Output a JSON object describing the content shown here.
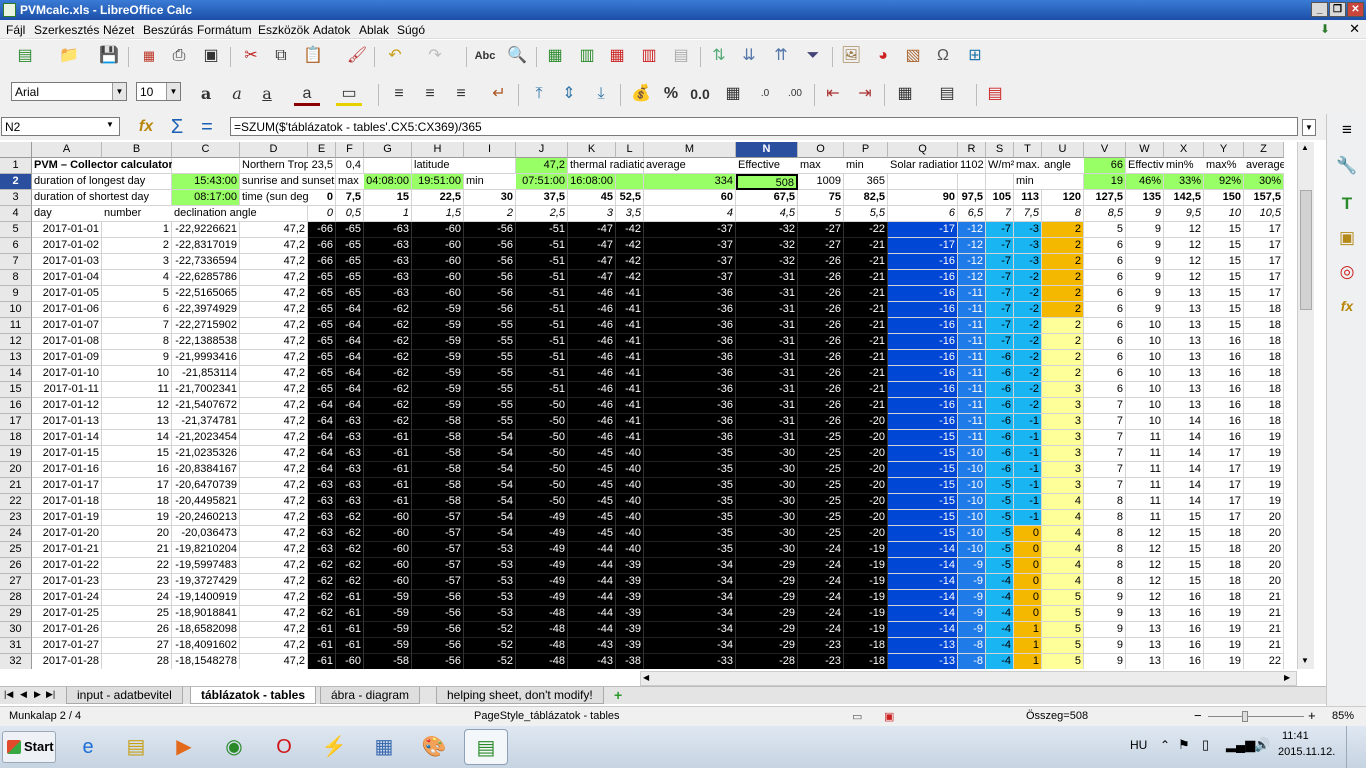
{
  "window": {
    "title": "PVMcalc.xls - LibreOffice Calc"
  },
  "menu": [
    "Fájl",
    "Szerkesztés",
    "Nézet",
    "Beszúrás",
    "Formátum",
    "Eszközök",
    "Adatok",
    "Ablak",
    "Súgó"
  ],
  "toolbar": {
    "font_name": "Arial",
    "font_size": "10",
    "percent_label": "%",
    "decimal_label": "0.0"
  },
  "formula_bar": {
    "name_box": "N2",
    "formula": "=SZUM($'táblázatok - tables'.CX5:CX369)/365"
  },
  "sheet": {
    "columns": [
      "A",
      "B",
      "C",
      "D",
      "E",
      "F",
      "G",
      "H",
      "I",
      "J",
      "K",
      "L",
      "M",
      "N",
      "O",
      "P",
      "Q",
      "R",
      "S",
      "T",
      "U",
      "V",
      "W",
      "X",
      "Y",
      "Z"
    ],
    "header_rows": [
      {
        "row": "1",
        "cells": [
          [
            "A",
            "PVM – Collector calculator"
          ],
          [
            "D",
            "Northern Tropic"
          ],
          [
            "E",
            "23,5"
          ],
          [
            "F",
            "0,4"
          ],
          [
            "H",
            "latitude"
          ],
          [
            "J",
            "47,2"
          ],
          [
            "K",
            "thermal radiation"
          ],
          [
            "M",
            "average"
          ],
          [
            "N",
            "Effective"
          ],
          [
            "O",
            "max"
          ],
          [
            "P",
            "min"
          ],
          [
            "Q",
            "Solar radiation"
          ],
          [
            "R",
            "1102"
          ],
          [
            "S",
            "W/m²"
          ],
          [
            "T",
            "max."
          ],
          [
            "U",
            "angle"
          ],
          [
            "V",
            "66"
          ],
          [
            "W",
            "Effective"
          ],
          [
            "X",
            "min%"
          ],
          [
            "Y",
            "max%"
          ],
          [
            "Z",
            "average"
          ]
        ]
      },
      {
        "row": "2",
        "cells": [
          [
            "A",
            "duration of longest day"
          ],
          [
            "C",
            "15:43:00"
          ],
          [
            "D",
            "sunrise and sunset"
          ],
          [
            "F",
            "max"
          ],
          [
            "G",
            "04:08:00"
          ],
          [
            "H",
            "19:51:00"
          ],
          [
            "I",
            "min"
          ],
          [
            "J",
            "07:51:00"
          ],
          [
            "K",
            "16:08:00"
          ],
          [
            "M",
            "334"
          ],
          [
            "N",
            "508"
          ],
          [
            "O",
            "1009"
          ],
          [
            "P",
            "365"
          ],
          [
            "T",
            "min"
          ],
          [
            "V",
            "19"
          ],
          [
            "W",
            "46%"
          ],
          [
            "X",
            "33%"
          ],
          [
            "Y",
            "92%"
          ],
          [
            "Z",
            "30%"
          ]
        ]
      },
      {
        "row": "3",
        "cells": [
          [
            "A",
            "duration of shortest day"
          ],
          [
            "C",
            "08:17:00"
          ],
          [
            "D",
            "time (sun degree)"
          ],
          [
            "E",
            "0"
          ],
          [
            "F",
            "7,5"
          ],
          [
            "G",
            "15"
          ],
          [
            "H",
            "22,5"
          ],
          [
            "I",
            "30"
          ],
          [
            "J",
            "37,5"
          ],
          [
            "K",
            "45"
          ],
          [
            "L",
            "52,5"
          ],
          [
            "M",
            "60"
          ],
          [
            "N",
            "67,5"
          ],
          [
            "O",
            "75"
          ],
          [
            "P",
            "82,5"
          ],
          [
            "Q",
            "90"
          ],
          [
            "R",
            "97,5"
          ],
          [
            "S",
            "105"
          ],
          [
            "T",
            "113"
          ],
          [
            "U",
            "120"
          ],
          [
            "V",
            "127,5"
          ],
          [
            "W",
            "135"
          ],
          [
            "X",
            "142,5"
          ],
          [
            "Y",
            "150"
          ],
          [
            "Z",
            "157,5"
          ]
        ]
      },
      {
        "row": "4",
        "cells": [
          [
            "A",
            "day"
          ],
          [
            "B",
            "number"
          ],
          [
            "C",
            "declination angle"
          ],
          [
            "E",
            "0"
          ],
          [
            "F",
            "0,5"
          ],
          [
            "G",
            "1"
          ],
          [
            "H",
            "1,5"
          ],
          [
            "I",
            "2"
          ],
          [
            "J",
            "2,5"
          ],
          [
            "K",
            "3"
          ],
          [
            "L",
            "3,5"
          ],
          [
            "M",
            "4"
          ],
          [
            "N",
            "4,5"
          ],
          [
            "O",
            "5"
          ],
          [
            "P",
            "5,5"
          ],
          [
            "Q",
            "6"
          ],
          [
            "R",
            "6,5"
          ],
          [
            "S",
            "7"
          ],
          [
            "T",
            "7,5"
          ],
          [
            "U",
            "8"
          ],
          [
            "V",
            "8,5"
          ],
          [
            "W",
            "9"
          ],
          [
            "X",
            "9,5"
          ],
          [
            "Y",
            "10"
          ],
          [
            "Z",
            "10,5"
          ]
        ]
      }
    ],
    "data_rows": [
      [
        "5",
        "2017-01-01",
        "1",
        "-22,9226621",
        "47,2",
        "-66",
        "-65",
        "-63",
        "-60",
        "-56",
        "-51",
        "-47",
        "-42",
        "-37",
        "-32",
        "-27",
        "-22",
        "-17",
        "-12",
        "-7",
        "-3",
        "2",
        "5",
        "9",
        "12",
        "15",
        "17"
      ],
      [
        "6",
        "2017-01-02",
        "2",
        "-22,8317019",
        "47,2",
        "-66",
        "-65",
        "-63",
        "-60",
        "-56",
        "-51",
        "-47",
        "-42",
        "-37",
        "-32",
        "-27",
        "-21",
        "-17",
        "-12",
        "-7",
        "-3",
        "2",
        "6",
        "9",
        "12",
        "15",
        "17"
      ],
      [
        "7",
        "2017-01-03",
        "3",
        "-22,7336594",
        "47,2",
        "-66",
        "-65",
        "-63",
        "-60",
        "-56",
        "-51",
        "-47",
        "-42",
        "-37",
        "-32",
        "-26",
        "-21",
        "-16",
        "-12",
        "-7",
        "-3",
        "2",
        "6",
        "9",
        "12",
        "15",
        "17"
      ],
      [
        "8",
        "2017-01-04",
        "4",
        "-22,6285786",
        "47,2",
        "-65",
        "-65",
        "-63",
        "-60",
        "-56",
        "-51",
        "-47",
        "-42",
        "-37",
        "-31",
        "-26",
        "-21",
        "-16",
        "-12",
        "-7",
        "-2",
        "2",
        "6",
        "9",
        "12",
        "15",
        "17"
      ],
      [
        "9",
        "2017-01-05",
        "5",
        "-22,5165065",
        "47,2",
        "-65",
        "-65",
        "-63",
        "-60",
        "-56",
        "-51",
        "-46",
        "-41",
        "-36",
        "-31",
        "-26",
        "-21",
        "-16",
        "-11",
        "-7",
        "-2",
        "2",
        "6",
        "9",
        "13",
        "15",
        "17"
      ],
      [
        "10",
        "2017-01-06",
        "6",
        "-22,3974929",
        "47,2",
        "-65",
        "-64",
        "-62",
        "-59",
        "-56",
        "-51",
        "-46",
        "-41",
        "-36",
        "-31",
        "-26",
        "-21",
        "-16",
        "-11",
        "-7",
        "-2",
        "2",
        "6",
        "9",
        "13",
        "15",
        "18"
      ],
      [
        "11",
        "2017-01-07",
        "7",
        "-22,2715902",
        "47,2",
        "-65",
        "-64",
        "-62",
        "-59",
        "-55",
        "-51",
        "-46",
        "-41",
        "-36",
        "-31",
        "-26",
        "-21",
        "-16",
        "-11",
        "-7",
        "-2",
        "2",
        "6",
        "10",
        "13",
        "15",
        "18"
      ],
      [
        "12",
        "2017-01-08",
        "8",
        "-22,1388538",
        "47,2",
        "-65",
        "-64",
        "-62",
        "-59",
        "-55",
        "-51",
        "-46",
        "-41",
        "-36",
        "-31",
        "-26",
        "-21",
        "-16",
        "-11",
        "-7",
        "-2",
        "2",
        "6",
        "10",
        "13",
        "16",
        "18"
      ],
      [
        "13",
        "2017-01-09",
        "9",
        "-21,9993416",
        "47,2",
        "-65",
        "-64",
        "-62",
        "-59",
        "-55",
        "-51",
        "-46",
        "-41",
        "-36",
        "-31",
        "-26",
        "-21",
        "-16",
        "-11",
        "-6",
        "-2",
        "2",
        "6",
        "10",
        "13",
        "16",
        "18"
      ],
      [
        "14",
        "2017-01-10",
        "10",
        "-21,853114",
        "47,2",
        "-65",
        "-64",
        "-62",
        "-59",
        "-55",
        "-51",
        "-46",
        "-41",
        "-36",
        "-31",
        "-26",
        "-21",
        "-16",
        "-11",
        "-6",
        "-2",
        "2",
        "6",
        "10",
        "13",
        "16",
        "18"
      ],
      [
        "15",
        "2017-01-11",
        "11",
        "-21,7002341",
        "47,2",
        "-65",
        "-64",
        "-62",
        "-59",
        "-55",
        "-51",
        "-46",
        "-41",
        "-36",
        "-31",
        "-26",
        "-21",
        "-16",
        "-11",
        "-6",
        "-2",
        "3",
        "6",
        "10",
        "13",
        "16",
        "18"
      ],
      [
        "16",
        "2017-01-12",
        "12",
        "-21,5407672",
        "47,2",
        "-64",
        "-64",
        "-62",
        "-59",
        "-55",
        "-50",
        "-46",
        "-41",
        "-36",
        "-31",
        "-26",
        "-21",
        "-16",
        "-11",
        "-6",
        "-2",
        "3",
        "7",
        "10",
        "13",
        "16",
        "18"
      ],
      [
        "17",
        "2017-01-13",
        "13",
        "-21,374781",
        "47,2",
        "-64",
        "-63",
        "-62",
        "-58",
        "-55",
        "-50",
        "-46",
        "-41",
        "-36",
        "-31",
        "-26",
        "-20",
        "-16",
        "-11",
        "-6",
        "-1",
        "3",
        "7",
        "10",
        "14",
        "16",
        "18"
      ],
      [
        "18",
        "2017-01-14",
        "14",
        "-21,2023454",
        "47,2",
        "-64",
        "-63",
        "-61",
        "-58",
        "-54",
        "-50",
        "-46",
        "-41",
        "-36",
        "-31",
        "-25",
        "-20",
        "-15",
        "-11",
        "-6",
        "-1",
        "3",
        "7",
        "11",
        "14",
        "16",
        "19"
      ],
      [
        "19",
        "2017-01-15",
        "15",
        "-21,0235326",
        "47,2",
        "-64",
        "-63",
        "-61",
        "-58",
        "-54",
        "-50",
        "-45",
        "-40",
        "-35",
        "-30",
        "-25",
        "-20",
        "-15",
        "-10",
        "-6",
        "-1",
        "3",
        "7",
        "11",
        "14",
        "17",
        "19"
      ],
      [
        "20",
        "2017-01-16",
        "16",
        "-20,8384167",
        "47,2",
        "-64",
        "-63",
        "-61",
        "-58",
        "-54",
        "-50",
        "-45",
        "-40",
        "-35",
        "-30",
        "-25",
        "-20",
        "-15",
        "-10",
        "-6",
        "-1",
        "3",
        "7",
        "11",
        "14",
        "17",
        "19"
      ],
      [
        "21",
        "2017-01-17",
        "17",
        "-20,6470739",
        "47,2",
        "-63",
        "-63",
        "-61",
        "-58",
        "-54",
        "-50",
        "-45",
        "-40",
        "-35",
        "-30",
        "-25",
        "-20",
        "-15",
        "-10",
        "-5",
        "-1",
        "3",
        "7",
        "11",
        "14",
        "17",
        "19"
      ],
      [
        "22",
        "2017-01-18",
        "18",
        "-20,4495821",
        "47,2",
        "-63",
        "-63",
        "-61",
        "-58",
        "-54",
        "-50",
        "-45",
        "-40",
        "-35",
        "-30",
        "-25",
        "-20",
        "-15",
        "-10",
        "-5",
        "-1",
        "4",
        "8",
        "11",
        "14",
        "17",
        "19"
      ],
      [
        "23",
        "2017-01-19",
        "19",
        "-20,2460213",
        "47,2",
        "-63",
        "-62",
        "-60",
        "-57",
        "-54",
        "-49",
        "-45",
        "-40",
        "-35",
        "-30",
        "-25",
        "-20",
        "-15",
        "-10",
        "-5",
        "-1",
        "4",
        "8",
        "11",
        "15",
        "17",
        "20"
      ],
      [
        "24",
        "2017-01-20",
        "20",
        "-20,036473",
        "47,2",
        "-63",
        "-62",
        "-60",
        "-57",
        "-54",
        "-49",
        "-45",
        "-40",
        "-35",
        "-30",
        "-25",
        "-20",
        "-15",
        "-10",
        "-5",
        "0",
        "4",
        "8",
        "12",
        "15",
        "18",
        "20"
      ],
      [
        "25",
        "2017-01-21",
        "21",
        "-19,8210204",
        "47,2",
        "-63",
        "-62",
        "-60",
        "-57",
        "-53",
        "-49",
        "-44",
        "-40",
        "-35",
        "-30",
        "-24",
        "-19",
        "-14",
        "-10",
        "-5",
        "0",
        "4",
        "8",
        "12",
        "15",
        "18",
        "20"
      ],
      [
        "26",
        "2017-01-22",
        "22",
        "-19,5997483",
        "47,2",
        "-62",
        "-62",
        "-60",
        "-57",
        "-53",
        "-49",
        "-44",
        "-39",
        "-34",
        "-29",
        "-24",
        "-19",
        "-14",
        "-9",
        "-5",
        "0",
        "4",
        "8",
        "12",
        "15",
        "18",
        "20"
      ],
      [
        "27",
        "2017-01-23",
        "23",
        "-19,3727429",
        "47,2",
        "-62",
        "-62",
        "-60",
        "-57",
        "-53",
        "-49",
        "-44",
        "-39",
        "-34",
        "-29",
        "-24",
        "-19",
        "-14",
        "-9",
        "-4",
        "0",
        "4",
        "8",
        "12",
        "15",
        "18",
        "20"
      ],
      [
        "28",
        "2017-01-24",
        "24",
        "-19,1400919",
        "47,2",
        "-62",
        "-61",
        "-59",
        "-56",
        "-53",
        "-49",
        "-44",
        "-39",
        "-34",
        "-29",
        "-24",
        "-19",
        "-14",
        "-9",
        "-4",
        "0",
        "5",
        "9",
        "12",
        "16",
        "18",
        "21"
      ],
      [
        "29",
        "2017-01-25",
        "25",
        "-18,9018841",
        "47,2",
        "-62",
        "-61",
        "-59",
        "-56",
        "-53",
        "-48",
        "-44",
        "-39",
        "-34",
        "-29",
        "-24",
        "-19",
        "-14",
        "-9",
        "-4",
        "0",
        "5",
        "9",
        "13",
        "16",
        "19",
        "21"
      ],
      [
        "30",
        "2017-01-26",
        "26",
        "-18,6582098",
        "47,2",
        "-61",
        "-61",
        "-59",
        "-56",
        "-52",
        "-48",
        "-44",
        "-39",
        "-34",
        "-29",
        "-24",
        "-19",
        "-14",
        "-9",
        "-4",
        "1",
        "5",
        "9",
        "13",
        "16",
        "19",
        "21"
      ],
      [
        "31",
        "2017-01-27",
        "27",
        "-18,4091602",
        "47,2",
        "-61",
        "-61",
        "-59",
        "-56",
        "-52",
        "-48",
        "-43",
        "-39",
        "-34",
        "-29",
        "-23",
        "-18",
        "-13",
        "-8",
        "-4",
        "1",
        "5",
        "9",
        "13",
        "16",
        "19",
        "21"
      ],
      [
        "32",
        "2017-01-28",
        "28",
        "-18,1548278",
        "47,2",
        "-61",
        "-60",
        "-58",
        "-56",
        "-52",
        "-48",
        "-43",
        "-38",
        "-33",
        "-28",
        "-23",
        "-18",
        "-13",
        "-8",
        "-4",
        "1",
        "5",
        "9",
        "13",
        "16",
        "19",
        "22"
      ]
    ]
  },
  "sheet_tabs": [
    "input - adatbevitel",
    "táblázatok - tables",
    "ábra - diagram",
    "helping sheet, don't modify!"
  ],
  "active_tab": "táblázatok - tables",
  "statusbar": {
    "sheet": "Munkalap 2 / 4",
    "page_style": "PageStyle_táblázatok - tables",
    "sum": "Összeg=508",
    "zoom": "85%"
  },
  "taskbar": {
    "start": "Start",
    "lang": "HU",
    "time": "11:41",
    "date": "2015.11.12."
  },
  "colors": {
    "black_block": "#000000",
    "blue_dark": "#0047d6",
    "blue_mid": "#1f7be8",
    "blue_light": "#19b4f2",
    "orange": "#f5b800",
    "light_yellow": "#ffff99",
    "green": "#99ff66",
    "selection": "#1a3d8f"
  }
}
